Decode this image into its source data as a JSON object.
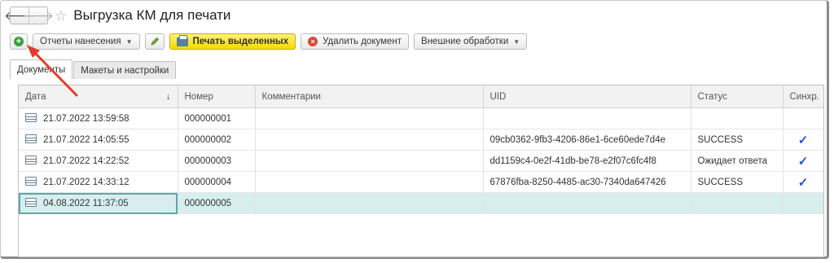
{
  "window": {
    "title": "Выгрузка КМ для печати"
  },
  "nav": {
    "back": "🡐",
    "forward": "🡒",
    "star": "☆"
  },
  "toolbar": {
    "add_icon": "plus-circle-icon",
    "reports_label": "Отчеты нанесения",
    "edit_icon": "pencil-icon",
    "print_label": "Печать выделенных",
    "delete_label": "Удалить документ",
    "external_label": "Внешние обработки"
  },
  "tabs": [
    {
      "label": "Документы",
      "active": true
    },
    {
      "label": "Макеты и настройки",
      "active": false
    }
  ],
  "table": {
    "columns": [
      "Дата",
      "Номер",
      "Комментарии",
      "UID",
      "Статус",
      "Синхр."
    ],
    "sort_indicator": "↓",
    "rows": [
      {
        "date": "21.07.2022 13:59:58",
        "number": "000000001",
        "comment": "",
        "uid": "",
        "status": "",
        "sync": ""
      },
      {
        "date": "21.07.2022 14:05:55",
        "number": "000000002",
        "comment": "",
        "uid": "09cb0362-9fb3-4206-86e1-6ce60ede7d4e",
        "status": "SUCCESS",
        "sync": "✓"
      },
      {
        "date": "21.07.2022 14:22:52",
        "number": "000000003",
        "comment": "",
        "uid": "dd1159c4-0e2f-41db-be78-e2f07c6fc4f8",
        "status": "Ожидает ответа",
        "sync": "✓"
      },
      {
        "date": "21.07.2022 14:33:12",
        "number": "000000004",
        "comment": "",
        "uid": "67876fba-8250-4485-ac30-7340da647426",
        "status": "SUCCESS",
        "sync": "✓"
      },
      {
        "date": "04.08.2022 11:37:05",
        "number": "000000005",
        "comment": "",
        "uid": "",
        "status": "",
        "sync": ""
      }
    ],
    "selected_row": 4
  },
  "colors": {
    "accent_yellow": "#f5d900",
    "annotation_red": "#e53b2c",
    "selection": "#d8eeee",
    "check_blue": "#1a56d0"
  }
}
